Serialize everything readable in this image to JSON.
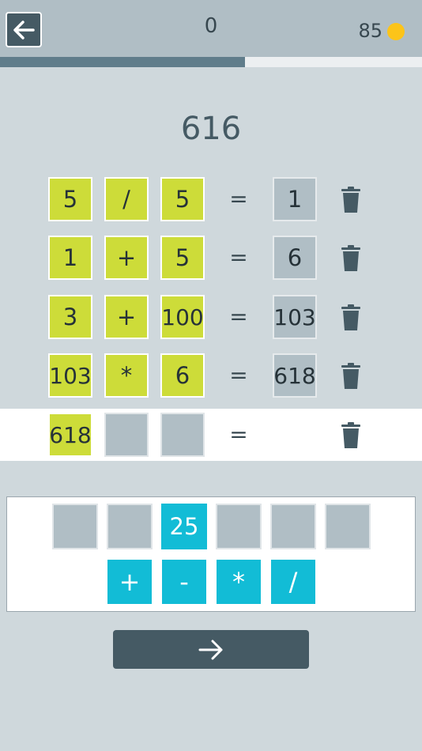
{
  "header": {
    "score": "0",
    "coins": "85",
    "progress": 0.58
  },
  "target": "616",
  "rows": [
    {
      "a": "5",
      "op": "/",
      "b": "5",
      "eq": "=",
      "result": "1"
    },
    {
      "a": "1",
      "op": "+",
      "b": "5",
      "eq": "=",
      "result": "6"
    },
    {
      "a": "3",
      "op": "+",
      "b": "100",
      "eq": "=",
      "result": "103"
    },
    {
      "a": "103",
      "op": "*",
      "b": "6",
      "eq": "=",
      "result": "618"
    },
    {
      "a": "618",
      "op": "",
      "b": "",
      "eq": "=",
      "result": ""
    }
  ],
  "pool": {
    "numbers": [
      "",
      "",
      "25",
      "",
      "",
      ""
    ],
    "operators": [
      "+",
      "-",
      "*",
      "/"
    ]
  },
  "colors": {
    "yellow": "#cddc39",
    "cyan": "#12bcd6",
    "dark": "#455a64",
    "coin": "#fcc419"
  },
  "icons": {
    "back": "arrow-left-icon",
    "coin": "coin-icon",
    "delete": "trash-icon",
    "submit": "arrow-right-icon"
  }
}
